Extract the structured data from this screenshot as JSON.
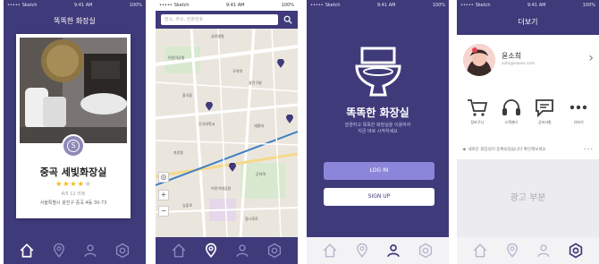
{
  "status": {
    "carrier": "Sketch",
    "time": "9:41 AM",
    "battery": "100%"
  },
  "screen1": {
    "title": "똑똑한 화장실",
    "badge_glyph": "S",
    "place_name": "중곡 세빛화장실",
    "rating": 4,
    "rating_text": "4/5 12 리뷰",
    "address": "서울특별시 광진구 중곡 4동 30-73"
  },
  "screen2": {
    "search_placeholder": "장소, 주소, 전화번호",
    "map_labels": [
      "성모병원",
      "어린이공원",
      "구의역",
      "중곡동",
      "광진구청",
      "건국대학교",
      "세종대",
      "자양동",
      "군자역",
      "어린이대공원",
      "능동로",
      "광나루로"
    ],
    "zoom_in": "+",
    "zoom_out": "−"
  },
  "screen3": {
    "app_name": "똑똑한 화장실",
    "tagline_1": "깔끔하고 똑똑한 화장실을 이용하자",
    "tagline_2": "지금 바로 시작하세요",
    "login_label": "LOG IN",
    "signup_label": "SIGN UP"
  },
  "screen4": {
    "title": "더보기",
    "user_name": "윤소희",
    "user_email": "sohi@naver.com",
    "menu": [
      {
        "label": "장바구니",
        "icon": "cart-icon"
      },
      {
        "label": "고객센터",
        "icon": "headset-icon"
      },
      {
        "label": "공지사항",
        "icon": "chat-icon"
      },
      {
        "label": "더보기",
        "icon": "more-icon"
      }
    ],
    "notice_text": "새로운 화장실이 등록되었습니다 확인해보세요",
    "ad_text": "광고 부분"
  },
  "colors": {
    "brand": "#3f3a7a",
    "accent": "#8b86d9",
    "star": "#f2b705"
  }
}
